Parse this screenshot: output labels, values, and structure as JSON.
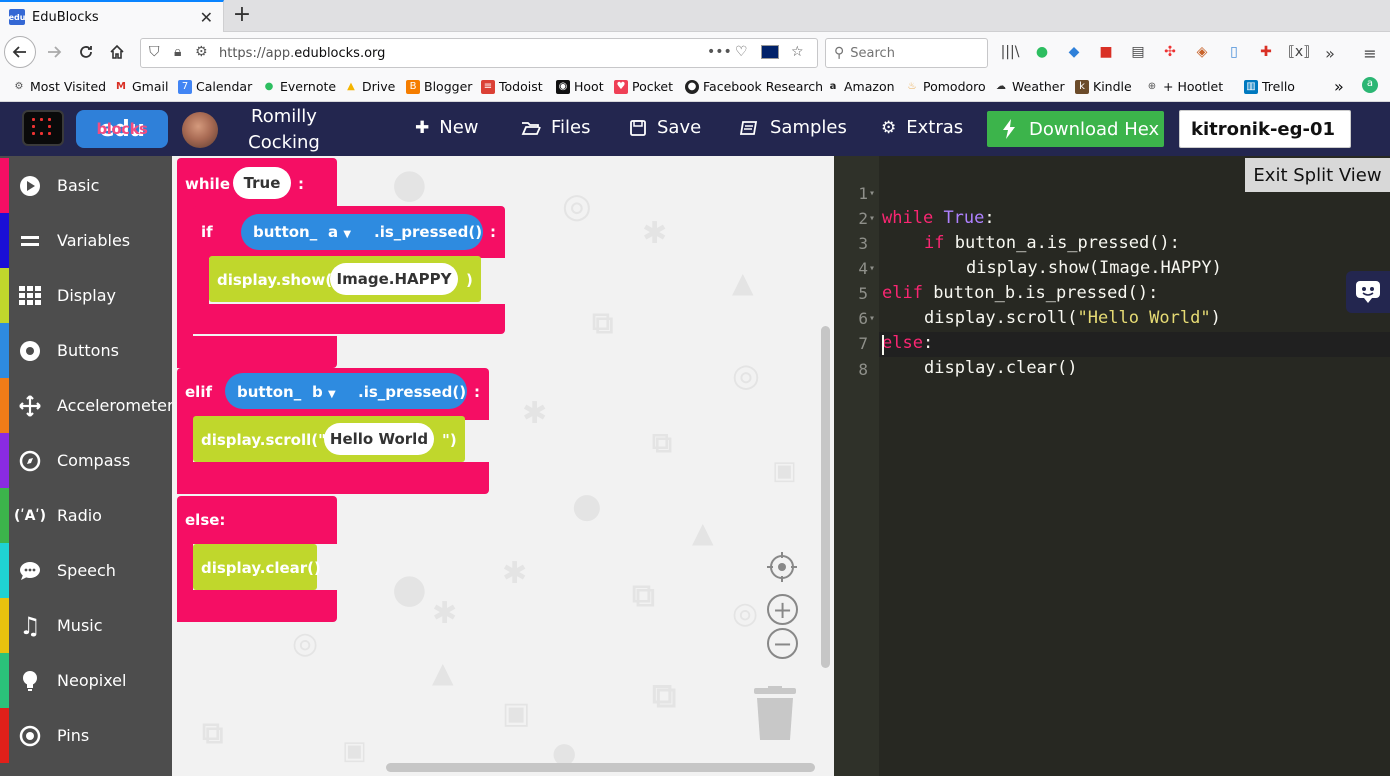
{
  "browser": {
    "tab_title": "EduBlocks",
    "tab_favicon_text": "edu",
    "url_prefix": "https://app.",
    "url_domain": "edublocks.org",
    "search_placeholder": "Search",
    "bookmarks": [
      {
        "label": "Most Visited",
        "color": "#555555",
        "icon": "gear-icon"
      },
      {
        "label": "Gmail",
        "color": "#d93025",
        "icon": "gmail-icon"
      },
      {
        "label": "Calendar",
        "color": "#4285f4",
        "icon": "calendar-icon"
      },
      {
        "label": "Evernote",
        "color": "#2dbe60",
        "icon": "evernote-icon"
      },
      {
        "label": "Drive",
        "color": "#f4b400",
        "icon": "drive-icon"
      },
      {
        "label": "Blogger",
        "color": "#f57d00",
        "icon": "blogger-icon"
      },
      {
        "label": "Todoist",
        "color": "#db4035",
        "icon": "todoist-icon"
      },
      {
        "label": "Hoot",
        "color": "#111111",
        "icon": "hootsuite-icon"
      },
      {
        "label": "Pocket",
        "color": "#ef4056",
        "icon": "pocket-icon"
      },
      {
        "label": "Facebook Research",
        "color": "#222222",
        "icon": "github-icon"
      },
      {
        "label": "Amazon",
        "color": "#222222",
        "icon": "amazon-icon"
      },
      {
        "label": "Pomodoro",
        "color": "#e8a13a",
        "icon": "pomodoro-icon"
      },
      {
        "label": "Weather",
        "color": "#333333",
        "icon": "weather-icon"
      },
      {
        "label": "Kindle",
        "color": "#6b4b2a",
        "icon": "kindle-icon"
      },
      {
        "label": "+ Hootlet",
        "color": "#555555",
        "icon": "globe-icon"
      },
      {
        "label": "Trello",
        "color": "#0079bf",
        "icon": "trello-icon"
      }
    ]
  },
  "header": {
    "logo_edu": "edu",
    "logo_blocks": "blocks",
    "user_first": "Romilly",
    "user_last": "Cocking",
    "menu": {
      "new": "New",
      "files": "Files",
      "save": "Save",
      "samples": "Samples",
      "extras": "Extras"
    },
    "download_label": "Download Hex",
    "project_name": "kitronik-eg-01",
    "accent_green": "#3cb44b",
    "header_bg": "#23264f"
  },
  "sidebar": {
    "categories": [
      {
        "label": "Basic",
        "color": "#f50e64",
        "icon": "play-circle-icon"
      },
      {
        "label": "Variables",
        "color": "#1a0fd6",
        "icon": "equals-icon"
      },
      {
        "label": "Display",
        "color": "#c0d72c",
        "icon": "grid-icon"
      },
      {
        "label": "Buttons",
        "color": "#2e8be0",
        "icon": "dot-circle-icon"
      },
      {
        "label": "Accelerometer",
        "color": "#f07c18",
        "icon": "move-arrows-icon"
      },
      {
        "label": "Compass",
        "color": "#8a2be2",
        "icon": "compass-icon"
      },
      {
        "label": "Radio",
        "color": "#3cb44b",
        "icon": "antenna-icon"
      },
      {
        "label": "Speech",
        "color": "#1fd2d2",
        "icon": "speech-bubble-icon"
      },
      {
        "label": "Music",
        "color": "#e8c20e",
        "icon": "music-note-icon"
      },
      {
        "label": "Neopixel",
        "color": "#2bc27a",
        "icon": "lightbulb-icon"
      },
      {
        "label": "Pins",
        "color": "#e0201a",
        "icon": "target-icon"
      }
    ]
  },
  "blocks": {
    "while_kw": "while",
    "while_val": "True",
    "colon": ":",
    "if_kw": "if",
    "button_prefix": "button_",
    "button_a": "a",
    "button_b": "b",
    "is_pressed": ".is_pressed()",
    "show_fn": "display.show(",
    "image_val": "Image.HAPPY",
    "close_paren": ")",
    "elif_kw": "elif",
    "scroll_fn": "display.scroll(\"",
    "hello_val": "Hello World",
    "scroll_close": "\")",
    "else_kw": "else:",
    "clear_fn": "display.clear()",
    "dropdown_arrow": "▼"
  },
  "editor": {
    "exit_split_label": "Exit Split View",
    "lines": [
      {
        "n": "1",
        "fold": "▾"
      },
      {
        "n": "2",
        "fold": "▾"
      },
      {
        "n": "3",
        "fold": ""
      },
      {
        "n": "4",
        "fold": "▾"
      },
      {
        "n": "5",
        "fold": ""
      },
      {
        "n": "6",
        "fold": "▾"
      },
      {
        "n": "7",
        "fold": ""
      },
      {
        "n": "8",
        "fold": ""
      }
    ],
    "code": {
      "l1_kw": "while",
      "l1_const": "True",
      "l1_rest": ":",
      "l2_kw": "if",
      "l2_rest": " button_a.is_pressed():",
      "l3": "display.show(Image.HAPPY)",
      "l4_kw": "elif",
      "l4_rest": " button_b.is_pressed():",
      "l5_pre": "display.scroll(",
      "l5_str": "\"Hello World\"",
      "l5_post": ")",
      "l6_kw": "else",
      "l6_rest": ":",
      "l7": "display.clear()"
    }
  }
}
